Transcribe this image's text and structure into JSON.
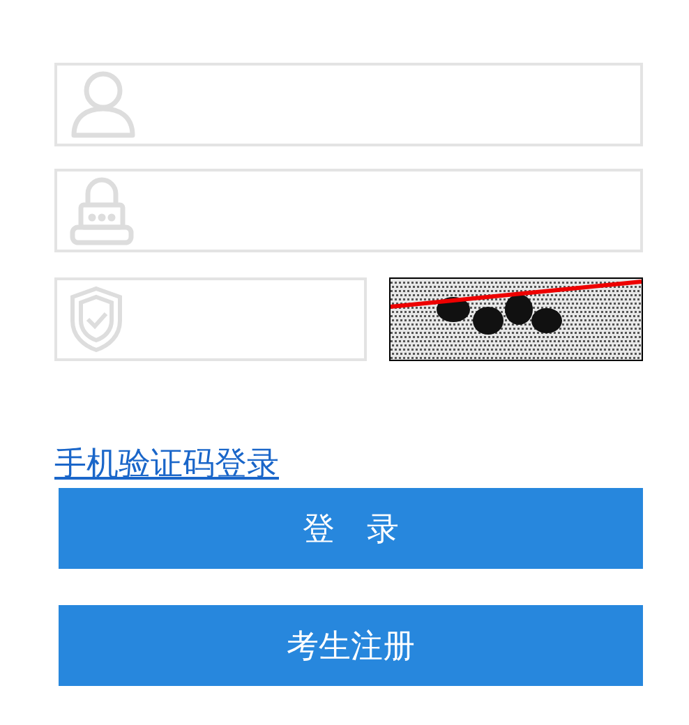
{
  "fields": [
    {
      "kind": "user"
    },
    {
      "kind": "lock"
    }
  ],
  "sms_login_link": "手机验证码登录",
  "buttons": [
    "登　录",
    "考生注册"
  ]
}
